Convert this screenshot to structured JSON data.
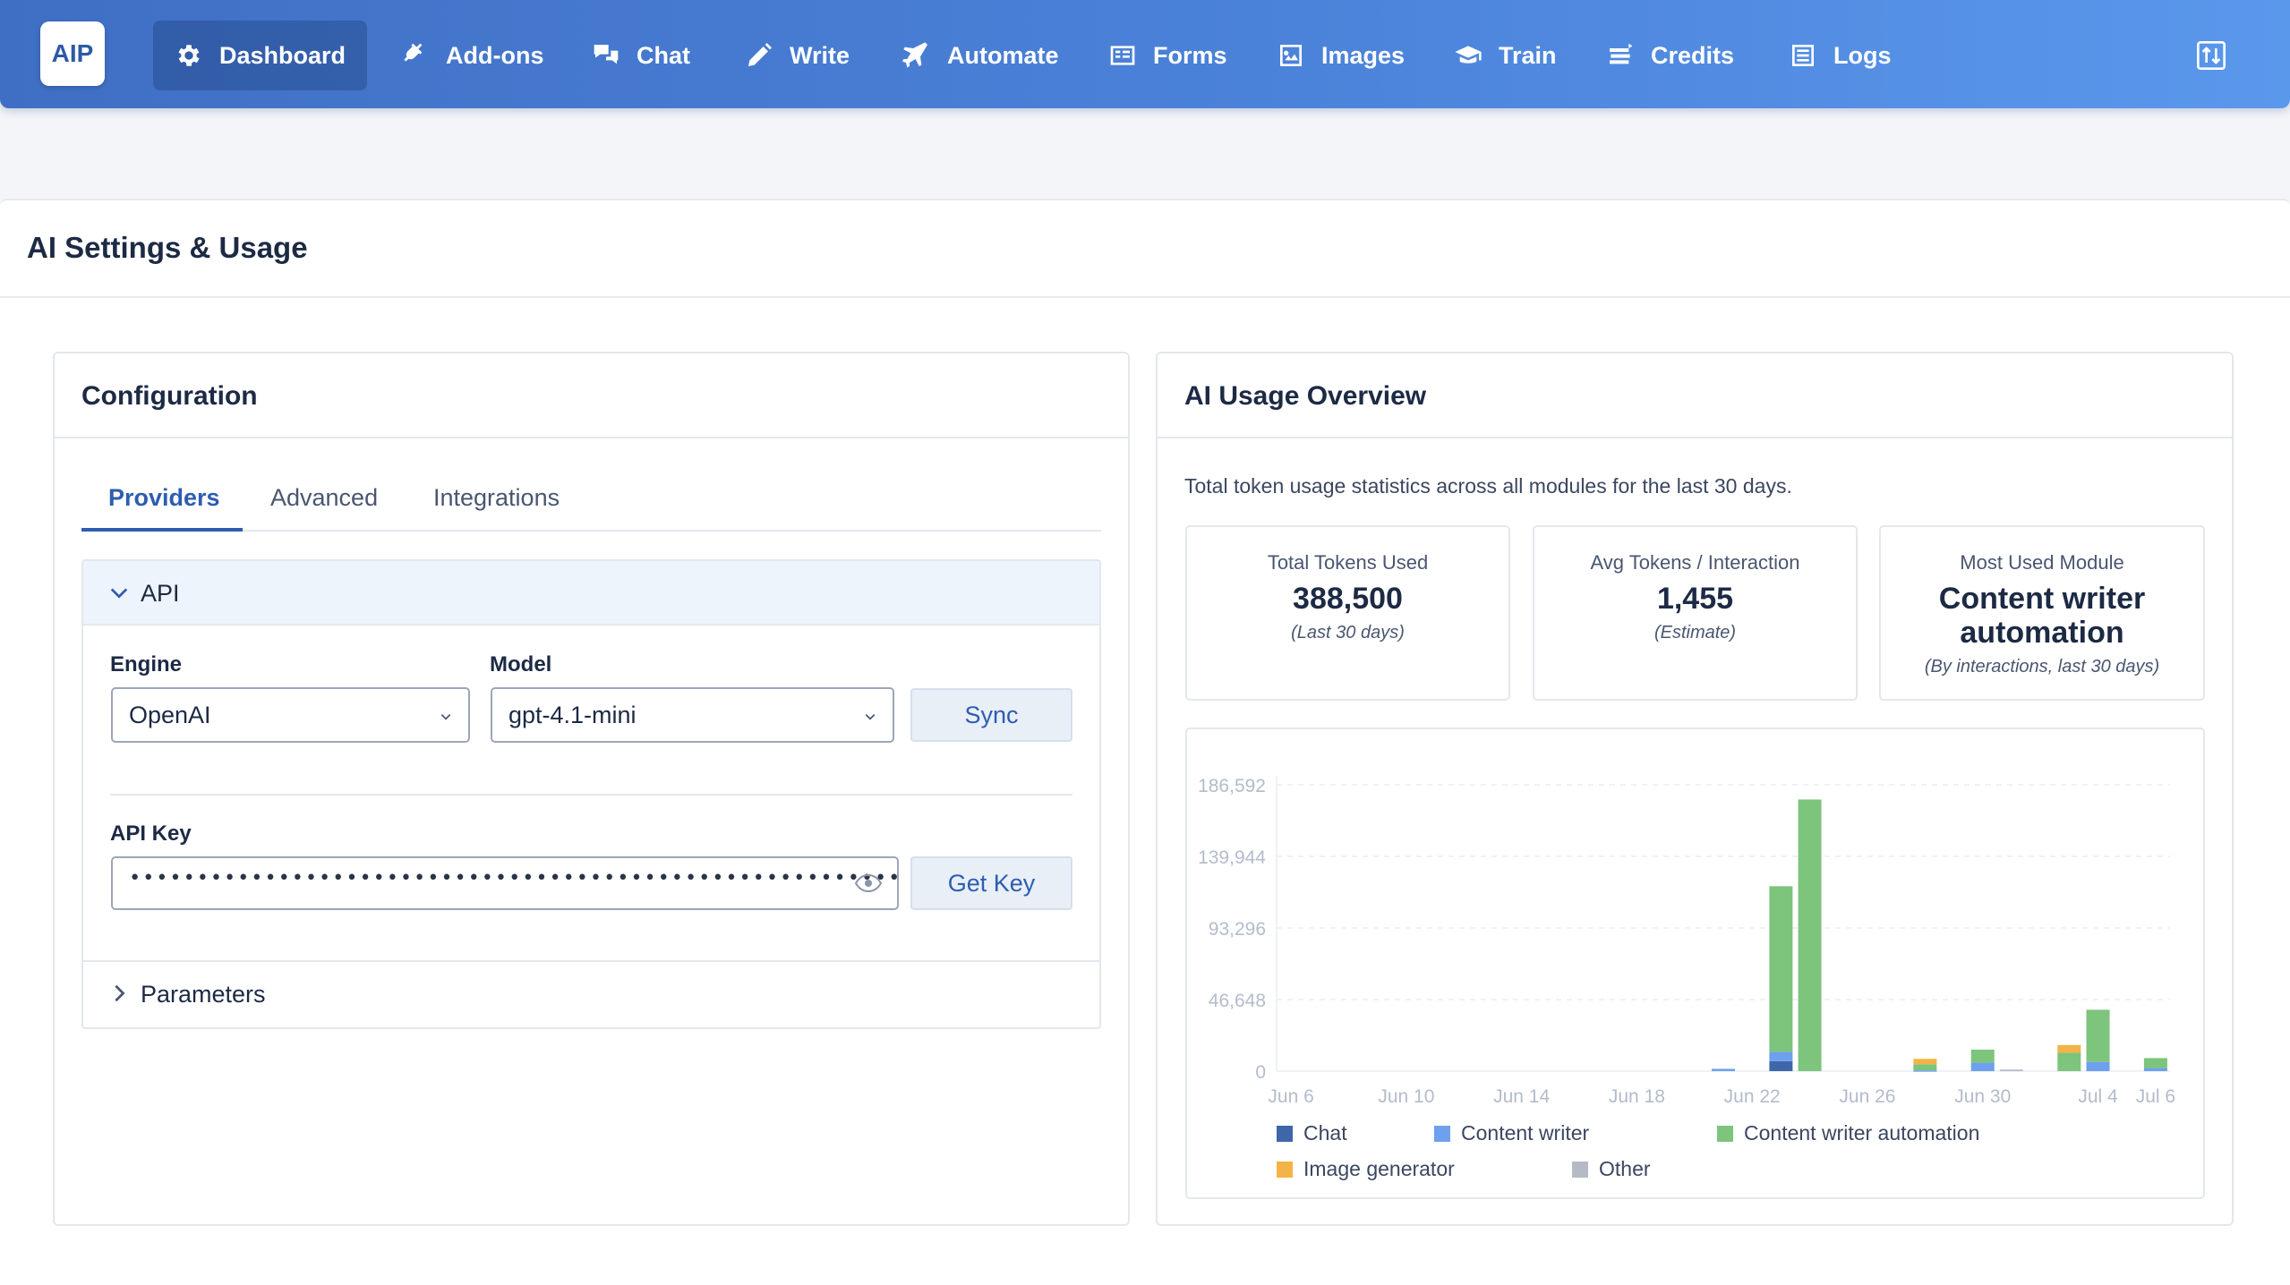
{
  "nav": {
    "logo": "AIP",
    "items": [
      {
        "label": "Dashboard",
        "icon": "gear-icon"
      },
      {
        "label": "Add-ons",
        "icon": "plug-icon"
      },
      {
        "label": "Chat",
        "icon": "chat-bubbles-icon"
      },
      {
        "label": "Write",
        "icon": "pencil-icon"
      },
      {
        "label": "Automate",
        "icon": "plane-icon"
      },
      {
        "label": "Forms",
        "icon": "form-icon"
      },
      {
        "label": "Images",
        "icon": "image-icon"
      },
      {
        "label": "Train",
        "icon": "graduation-cap-icon"
      },
      {
        "label": "Credits",
        "icon": "coins-icon"
      },
      {
        "label": "Logs",
        "icon": "list-icon"
      }
    ],
    "active": "Dashboard",
    "right_icon": "sort-toggle-icon"
  },
  "page": {
    "title": "AI Settings & Usage"
  },
  "config": {
    "title": "Configuration",
    "tabs": [
      "Providers",
      "Advanced",
      "Integrations"
    ],
    "active_tab": "Providers",
    "api_section": "API",
    "engine_label": "Engine",
    "engine_value": "OpenAI",
    "model_label": "Model",
    "model_value": "gpt-4.1-mini",
    "sync_label": "Sync",
    "api_key_label": "API Key",
    "api_key_value": "••••••••••••••••••••••••••••••••••••••••••••••••••••••••••••••••",
    "get_key_label": "Get Key",
    "parameters_section": "Parameters"
  },
  "usage": {
    "title": "AI Usage Overview",
    "description": "Total token usage statistics across all modules for the last 30 days.",
    "stats": [
      {
        "label": "Total Tokens Used",
        "value": "388,500",
        "note": "(Last 30 days)"
      },
      {
        "label": "Avg Tokens / Interaction",
        "value": "1,455",
        "note": "(Estimate)"
      },
      {
        "label": "Most Used Module",
        "value": "Content writer automation",
        "note": "(By interactions, last 30 days)"
      }
    ]
  },
  "colors": {
    "chat": "#3f66a8",
    "content_writer": "#6ea0ee",
    "content_writer_automation": "#7dc47c",
    "image_generator": "#f4b347",
    "other": "#b5bbc4"
  },
  "chart_data": {
    "type": "bar",
    "stacked": true,
    "x_ticks": [
      "Jun 6",
      "Jun 10",
      "Jun 14",
      "Jun 18",
      "Jun 22",
      "Jun 26",
      "Jun 30",
      "Jul 4",
      "Jul 6"
    ],
    "y_ticks": [
      "0",
      "46,648",
      "93,296",
      "139,944",
      "186,592"
    ],
    "ylim": [
      0,
      186592
    ],
    "categories": [
      "Jun 6",
      "Jun 7",
      "Jun 8",
      "Jun 9",
      "Jun 10",
      "Jun 11",
      "Jun 12",
      "Jun 13",
      "Jun 14",
      "Jun 15",
      "Jun 16",
      "Jun 17",
      "Jun 18",
      "Jun 19",
      "Jun 20",
      "Jun 21",
      "Jun 22",
      "Jun 23",
      "Jun 24",
      "Jun 25",
      "Jun 26",
      "Jun 27",
      "Jun 28",
      "Jun 29",
      "Jun 30",
      "Jul 1",
      "Jul 2",
      "Jul 3",
      "Jul 4",
      "Jul 5",
      "Jul 6"
    ],
    "series": [
      {
        "name": "Chat",
        "values": [
          0,
          0,
          0,
          0,
          0,
          0,
          0,
          0,
          0,
          0,
          0,
          0,
          0,
          0,
          0,
          0,
          0,
          6500,
          0,
          0,
          0,
          0,
          0,
          0,
          0,
          0,
          0,
          0,
          0,
          0,
          0
        ]
      },
      {
        "name": "Content writer",
        "values": [
          0,
          0,
          0,
          0,
          0,
          0,
          0,
          0,
          0,
          0,
          0,
          0,
          0,
          0,
          0,
          1500,
          0,
          6000,
          0,
          0,
          0,
          0,
          500,
          0,
          5500,
          0,
          0,
          0,
          6000,
          0,
          2000
        ]
      },
      {
        "name": "Content writer automation",
        "values": [
          0,
          0,
          0,
          0,
          0,
          0,
          0,
          0,
          0,
          0,
          0,
          0,
          0,
          0,
          0,
          0,
          0,
          108000,
          177000,
          0,
          0,
          0,
          4000,
          0,
          8500,
          0,
          0,
          12000,
          34000,
          0,
          6500
        ]
      },
      {
        "name": "Image generator",
        "values": [
          0,
          0,
          0,
          0,
          0,
          0,
          0,
          0,
          0,
          0,
          0,
          0,
          0,
          0,
          0,
          0,
          0,
          0,
          0,
          0,
          0,
          0,
          3500,
          0,
          0,
          0,
          0,
          5000,
          0,
          0,
          0
        ]
      },
      {
        "name": "Other",
        "values": [
          0,
          0,
          0,
          0,
          0,
          0,
          0,
          0,
          0,
          0,
          0,
          0,
          0,
          0,
          0,
          0,
          0,
          0,
          0,
          0,
          0,
          0,
          0,
          0,
          0,
          1000,
          0,
          0,
          0,
          0,
          0
        ]
      }
    ],
    "legend_position": "bottom"
  }
}
